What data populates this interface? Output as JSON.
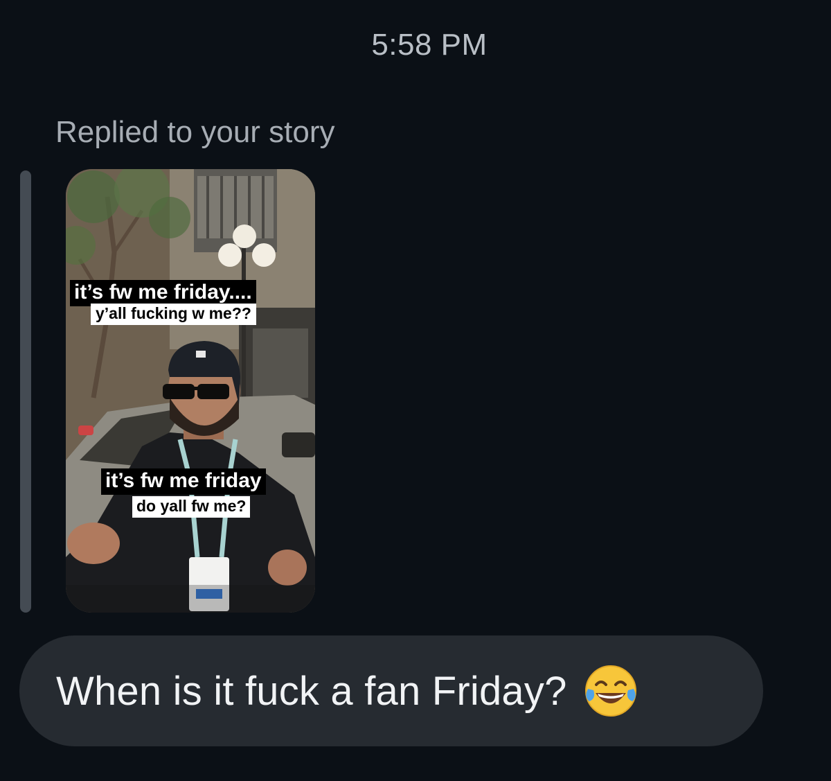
{
  "header": {
    "timestamp": "5:58 PM"
  },
  "story_reply": {
    "label": "Replied to your story",
    "captions": {
      "top_line": "it’s fw me friday....",
      "top_subline": "y’all fucking w me??",
      "bottom_line": "it’s fw me friday",
      "bottom_subline": "do yall fw me?"
    }
  },
  "message": {
    "text": "When is it fuck a fan Friday?",
    "emoji": "face-with-tears-of-joy-icon"
  },
  "colors": {
    "background": "#0b1016",
    "bubble": "#262b31",
    "reply_bar": "#444b53",
    "secondary_text": "#a7adb4"
  }
}
